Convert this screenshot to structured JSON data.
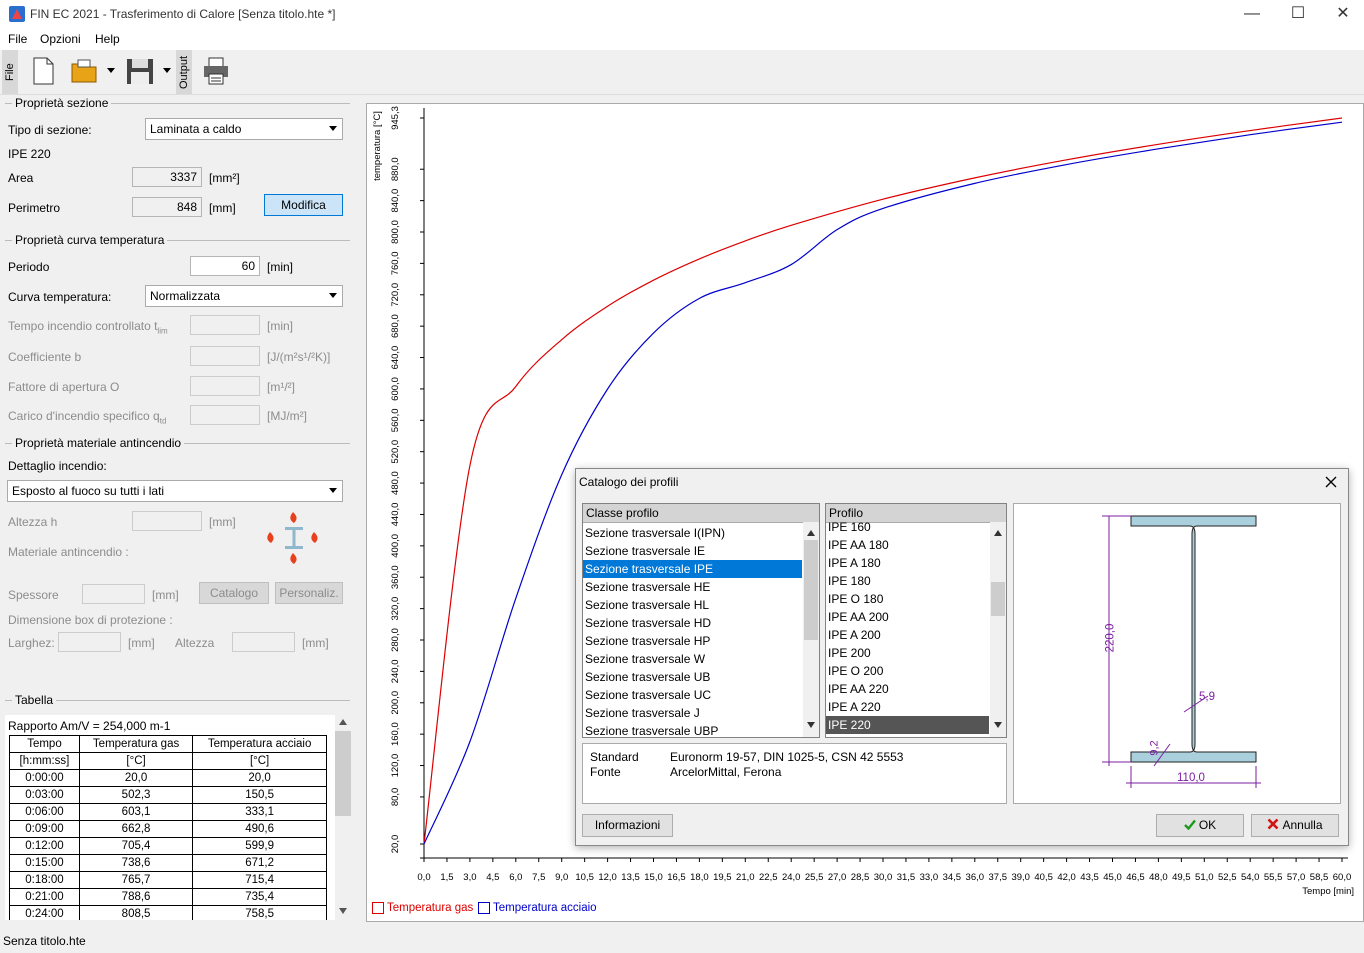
{
  "window": {
    "title": "FIN EC 2021 - Trasferimento di Calore [Senza titolo.hte *]",
    "min": "—",
    "max": "☐",
    "close": "✕"
  },
  "menu": [
    "File",
    "Opzioni",
    "Help"
  ],
  "toolbar": {
    "file_tab": "File",
    "output_tab": "Output"
  },
  "section": {
    "group": "Proprietà sezione",
    "tipo_label": "Tipo di sezione:",
    "tipo_value": "Laminata a caldo",
    "profile_name": "IPE 220",
    "area_label": "Area",
    "area_value": "3337",
    "area_unit": "[mm²]",
    "perimetro_label": "Perimetro",
    "perimetro_value": "848",
    "perimetro_unit": "[mm]",
    "modifica": "Modifica"
  },
  "curve": {
    "group": "Proprietà curva temperatura",
    "periodo_label": "Periodo",
    "periodo_value": "60",
    "periodo_unit": "[min]",
    "curva_label": "Curva temperatura:",
    "curva_value": "Normalizzata",
    "tempo_label": "Tempo incendio controllato t",
    "tempo_sub": "lim",
    "tempo_unit": "[min]",
    "coeff_label": "Coefficiente b",
    "coeff_unit": "[J/(m²s¹/²K)]",
    "fattore_label": "Fattore di apertura O",
    "fattore_unit": "[m¹/²]",
    "carico_label": "Carico d'incendio specifico q",
    "carico_sub": "td",
    "carico_unit": "[MJ/m²]"
  },
  "material": {
    "group": "Proprietà materiale antincendio",
    "dettaglio_label": "Dettaglio incendio:",
    "dettaglio_value": "Esposto al fuoco su tutti i lati",
    "altezza_label": "Altezza h",
    "altezza_unit": "[mm]",
    "materiale_label": "Materiale antincendio :",
    "spessore_label": "Spessore",
    "spessore_unit": "[mm]",
    "catalogo": "Catalogo",
    "personaliz": "Personaliz.",
    "box_label": "Dimensione box di protezione :",
    "larghez_label": "Larghez:",
    "larghez_unit": "[mm]",
    "altezza2_label": "Altezza",
    "altezza2_unit": "[mm]"
  },
  "tabella": {
    "group": "Tabella",
    "rapporto": "Rapporto Am/V = 254,000 m-1",
    "headers": [
      "Tempo",
      "Temperatura gas",
      "Temperatura acciaio"
    ],
    "units": [
      "[h:mm:ss]",
      "[°C]",
      "[°C]"
    ],
    "rows": [
      [
        "0:00:00",
        "20,0",
        "20,0"
      ],
      [
        "0:03:00",
        "502,3",
        "150,5"
      ],
      [
        "0:06:00",
        "603,1",
        "333,1"
      ],
      [
        "0:09:00",
        "662,8",
        "490,6"
      ],
      [
        "0:12:00",
        "705,4",
        "599,9"
      ],
      [
        "0:15:00",
        "738,6",
        "671,2"
      ],
      [
        "0:18:00",
        "765,7",
        "715,4"
      ],
      [
        "0:21:00",
        "788,6",
        "735,4"
      ],
      [
        "0:24:00",
        "808,5",
        "758,5"
      ]
    ]
  },
  "chart_data": {
    "type": "line",
    "ylabel": "temperatura [°C]",
    "xlabel": "Tempo [min]",
    "xlim": [
      0,
      60
    ],
    "ylim": [
      20,
      945.3
    ],
    "x_ticks": [
      "0,0",
      "1,5",
      "3,0",
      "4,5",
      "6,0",
      "7,5",
      "9,0",
      "10,5",
      "12,0",
      "13,5",
      "15,0",
      "16,5",
      "18,0",
      "19,5",
      "21,0",
      "22,5",
      "24,0",
      "25,5",
      "27,0",
      "28,5",
      "30,0",
      "31,5",
      "33,0",
      "34,5",
      "36,0",
      "37,5",
      "39,0",
      "40,5",
      "42,0",
      "43,5",
      "45,0",
      "46,5",
      "48,0",
      "49,5",
      "51,0",
      "52,5",
      "54,0",
      "55,5",
      "57,0",
      "58,5",
      "60,0"
    ],
    "y_ticks": [
      "20,0",
      "80,0",
      "120,0",
      "160,0",
      "200,0",
      "240,0",
      "280,0",
      "320,0",
      "360,0",
      "400,0",
      "440,0",
      "480,0",
      "520,0",
      "560,0",
      "600,0",
      "640,0",
      "680,0",
      "720,0",
      "760,0",
      "800,0",
      "840,0",
      "880,0",
      "945,3"
    ],
    "series": [
      {
        "name": "Temperatura gas",
        "color": "#dd0000",
        "x": [
          0,
          3,
          6,
          9,
          12,
          15,
          18,
          21,
          24,
          30,
          36,
          42,
          48,
          54,
          60
        ],
        "y": [
          20,
          502.3,
          603.1,
          662.8,
          705.4,
          738.6,
          765.7,
          788.6,
          808.5,
          841.8,
          869.0,
          892.0,
          911.8,
          929.3,
          945.3
        ]
      },
      {
        "name": "Temperatura acciaio",
        "color": "#0000cc",
        "x": [
          0,
          3,
          6,
          9,
          12,
          15,
          18,
          21,
          24,
          27,
          30,
          36,
          42,
          48,
          54,
          60
        ],
        "y": [
          20,
          150.5,
          333.1,
          490.6,
          599.9,
          671.2,
          715.4,
          735.4,
          758.5,
          803.0,
          830.0,
          862.0,
          886.0,
          906.0,
          924.0,
          940.0
        ]
      }
    ]
  },
  "dialog": {
    "title": "Catalogo dei profili",
    "classe_hdr": "Classe profilo",
    "classe_items": [
      "Sezione trasversale I(IPN)",
      "Sezione trasversale IE",
      "Sezione trasversale IPE",
      "Sezione trasversale HE",
      "Sezione trasversale HL",
      "Sezione trasversale HD",
      "Sezione trasversale HP",
      "Sezione trasversale W",
      "Sezione trasversale UB",
      "Sezione trasversale UC",
      "Sezione trasversale J",
      "Sezione trasversale UBP"
    ],
    "classe_selected": 2,
    "profilo_hdr": "Profilo",
    "profilo_items": [
      "IPE 160",
      "IPE AA 180",
      "IPE A 180",
      "IPE 180",
      "IPE O 180",
      "IPE AA 200",
      "IPE A 200",
      "IPE 200",
      "IPE O 200",
      "IPE AA 220",
      "IPE A 220",
      "IPE 220"
    ],
    "profilo_selected": 11,
    "standard_label": "Standard",
    "standard_value": "Euronorm 19-57, DIN 1025-5, CSN 42 5553",
    "fonte_label": "Fonte",
    "fonte_value": "ArcelorMittal, Ferona",
    "dim_h": "220,0",
    "dim_b": "110,0",
    "dim_tw": "5,9",
    "dim_tf": "9,2",
    "informazioni": "Informazioni",
    "ok": "OK",
    "annulla": "Annulla"
  },
  "status": "Senza titolo.hte"
}
